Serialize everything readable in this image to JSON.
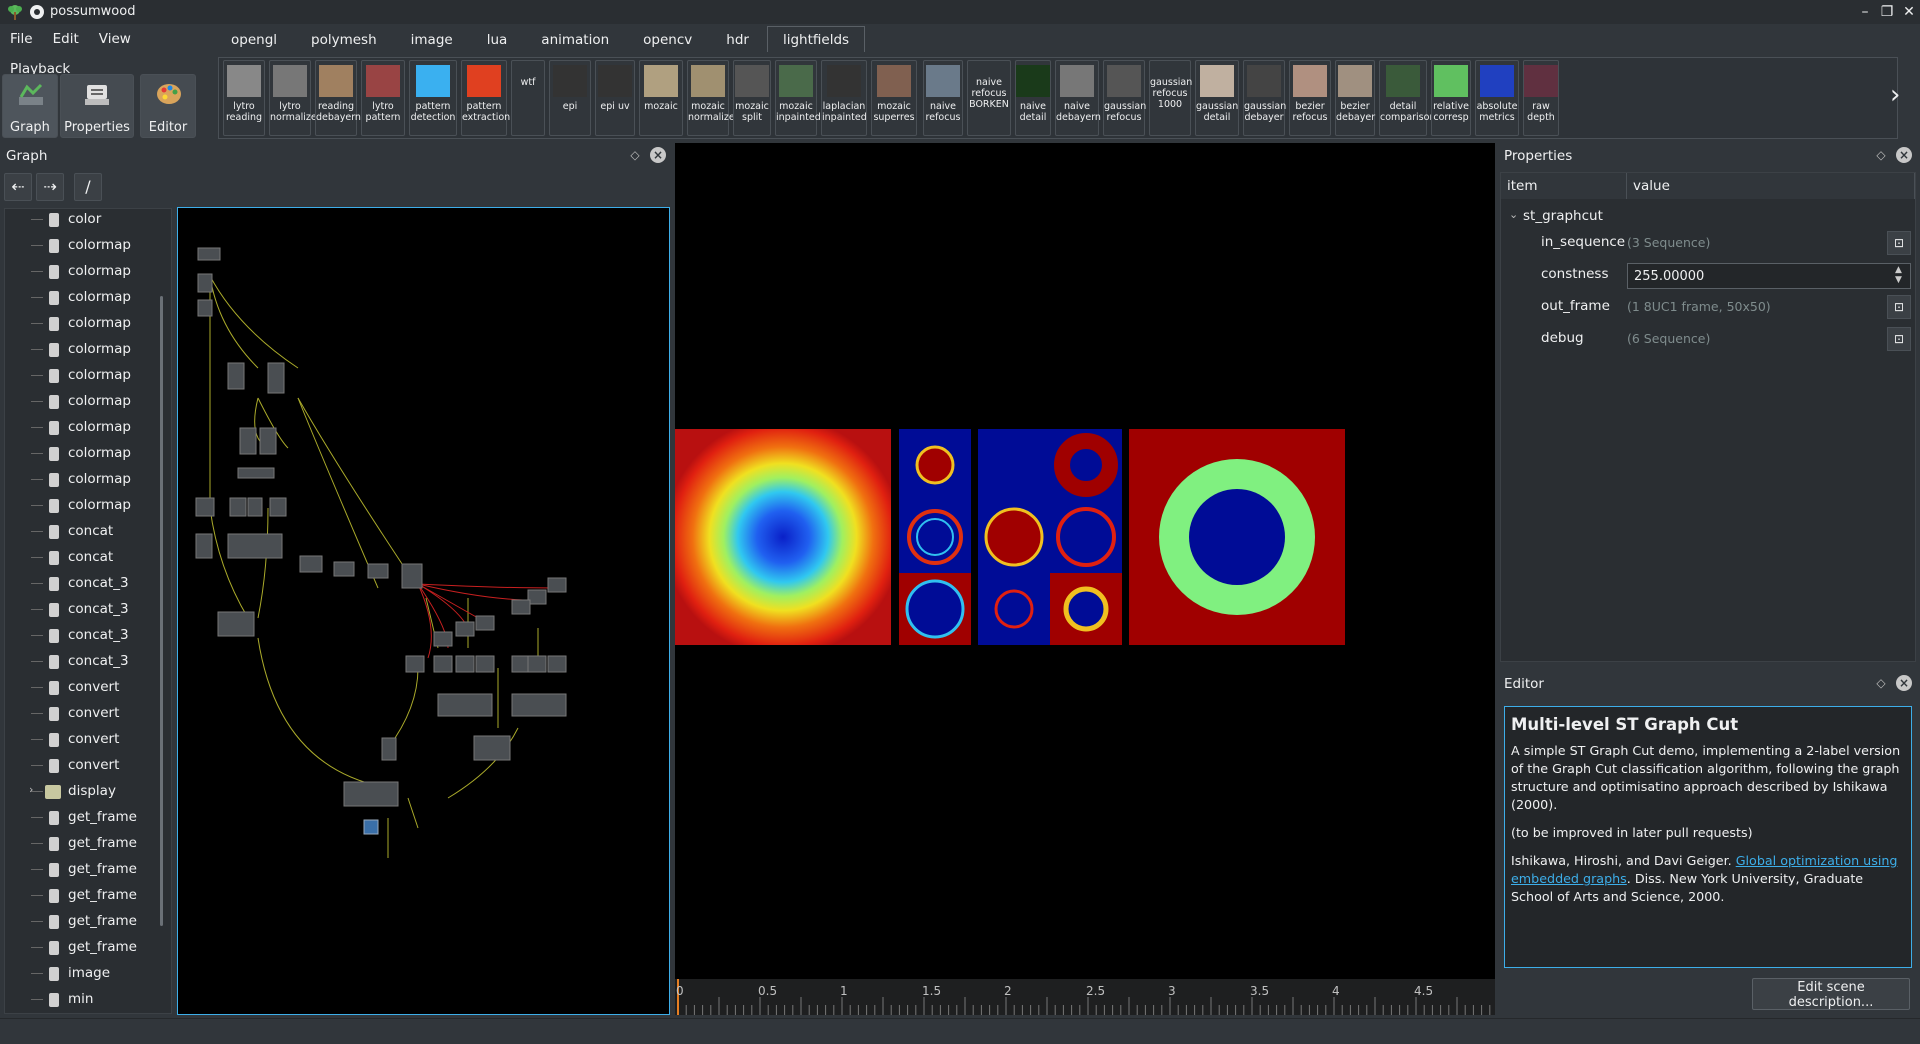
{
  "window": {
    "title": "possumwood"
  },
  "menu": [
    "File",
    "Edit",
    "View",
    "Playback"
  ],
  "tabs": [
    "opengl",
    "polymesh",
    "image",
    "lua",
    "animation",
    "opencv",
    "hdr",
    "lightfields"
  ],
  "modes": [
    "Graph",
    "Properties",
    "Editor"
  ],
  "tools": [
    {
      "label": "lytro reading"
    },
    {
      "label": "lytro normalize"
    },
    {
      "label": "reading debayern"
    },
    {
      "label": "lytro pattern"
    },
    {
      "label": "pattern detection"
    },
    {
      "label": "pattern extraction"
    },
    {
      "label": "wtf"
    },
    {
      "label": "epi"
    },
    {
      "label": "epi uv"
    },
    {
      "label": "mozaic"
    },
    {
      "label": "mozaic normalize"
    },
    {
      "label": "mozaic split"
    },
    {
      "label": "mozaic inpainted"
    },
    {
      "label": "laplacian inpainted"
    },
    {
      "label": "mozaic superres"
    },
    {
      "label": "naive refocus"
    },
    {
      "label": "naive refocus BORKEN"
    },
    {
      "label": "naive detail"
    },
    {
      "label": "naive debayern"
    },
    {
      "label": "gaussian refocus"
    },
    {
      "label": "gaussian refocus 1000"
    },
    {
      "label": "gaussian detail"
    },
    {
      "label": "gaussian debayer"
    },
    {
      "label": "bezier refocus"
    },
    {
      "label": "bezier debayer"
    },
    {
      "label": "detail comparison"
    },
    {
      "label": "relative corresp"
    },
    {
      "label": "absolute metrics"
    },
    {
      "label": "raw depth"
    }
  ],
  "graph_panel": {
    "title": "Graph",
    "path": "/",
    "tree": [
      "color",
      "colormap",
      "colormap",
      "colormap",
      "colormap",
      "colormap",
      "colormap",
      "colormap",
      "colormap",
      "colormap",
      "colormap",
      "colormap",
      "concat",
      "concat",
      "concat_3",
      "concat_3",
      "concat_3",
      "concat_3",
      "convert",
      "convert",
      "convert",
      "convert",
      "display",
      "get_frame",
      "get_frame",
      "get_frame",
      "get_frame",
      "get_frame",
      "get_frame",
      "image",
      "min"
    ]
  },
  "properties_panel": {
    "title": "Properties",
    "col_item": "item",
    "col_value": "value",
    "node": "st_graphcut",
    "rows": [
      {
        "name": "in_sequence",
        "value": "(3 Sequence)"
      },
      {
        "name": "constness",
        "value": "255.00000"
      },
      {
        "name": "out_frame",
        "value": "(1 8UC1 frame, 50x50)"
      },
      {
        "name": "debug",
        "value": "(6 Sequence)"
      }
    ]
  },
  "editor_panel": {
    "title": "Editor",
    "heading": "Multi-level ST Graph Cut",
    "para1": "A simple ST Graph Cut demo, implementing a 2-label version of the Graph Cut classification algorithm, following the graph structure and optimisatino approach described by Ishikawa (2000).",
    "para2": "(to be improved in later pull requests)",
    "ref_authors": "Ishikawa, Hiroshi, and Davi Geiger. ",
    "ref_link": "Global optimization using embedded graphs",
    "ref_tail": ". Diss. New York University, Graduate School of Arts and Science, 2000.",
    "button": "Edit scene description..."
  },
  "timeline": {
    "ticks": [
      "0",
      "0.5",
      "1",
      "1.5",
      "2",
      "2.5",
      "3",
      "3.5",
      "4",
      "4.5"
    ]
  },
  "colors": {
    "accent": "#3daee9",
    "background": "#31363b",
    "panel": "#2a2e32"
  }
}
